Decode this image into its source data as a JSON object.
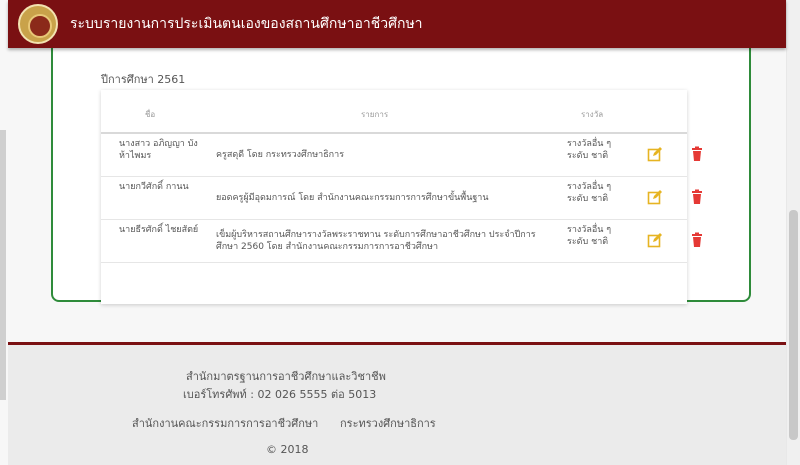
{
  "header": {
    "title": "ระบบรายงานการประเมินตนเองของสถานศึกษาอาชีวศึกษา"
  },
  "section": {
    "year_title": "ปีการศึกษา 2561"
  },
  "table": {
    "columns": [
      "ชื่อ",
      "รายการ",
      "รางวัล"
    ],
    "rows": [
      {
        "name": "นางสาว อภิญญา บัง ห้าไพมร",
        "item": "ครูสดุดี โดย กระทรวงศึกษาธิการ",
        "award": "รางวัลอื่น ๆ ระดับ ชาติ"
      },
      {
        "name": "นายกวีศักดิ์ กานน",
        "item": "ยอดครูผู้มีอุดมการณ์ โดย สำนักงานคณะกรรมการการศึกษาขั้นพื้นฐาน",
        "award": "รางวัลอื่น ๆ ระดับ ชาติ"
      },
      {
        "name": "นายธีรศักดิ์ ไชยสัตย์",
        "item": "เข็มผู้บริหารสถานศึกษารางวัลพระราชทาน ระดับการศึกษาอาชีวศึกษา ประจำปีการศึกษา 2560 โดย สำนักงานคณะกรรมการการอาชีวศึกษา",
        "award": "รางวัลอื่น ๆ ระดับ ชาติ"
      }
    ]
  },
  "footer": {
    "org": "สำนักมาตรฐานการอาชีวศึกษาและวิชาชีพ",
    "phone": "เบอร์โทรศัพท์ : 02 026 5555 ต่อ 5013",
    "dept1": "สำนักงานคณะกรรมการการอาชีวศึกษา",
    "dept2": "กระทรวงศึกษาธิการ",
    "copyright": "© 2018"
  },
  "colors": {
    "header_bg": "#7a1012",
    "card_border": "#2e8b3a",
    "edit_icon": "#e6b422",
    "delete_icon": "#e53935"
  },
  "icons": [
    "edit-icon",
    "trash-icon"
  ]
}
